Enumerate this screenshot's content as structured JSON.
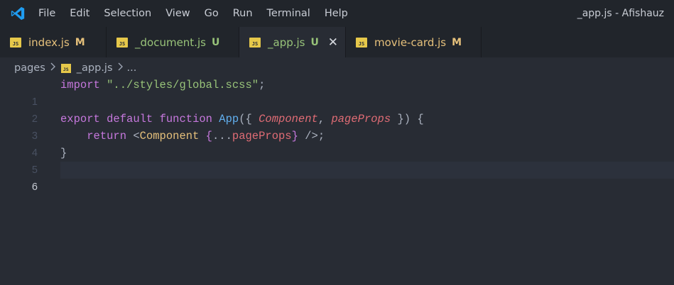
{
  "menu": [
    "File",
    "Edit",
    "Selection",
    "View",
    "Go",
    "Run",
    "Terminal",
    "Help"
  ],
  "window_title": "_app.js - Afishauz",
  "tabs": [
    {
      "label": "index.js",
      "status": "M",
      "label_color": "#e5c07b",
      "status_color": "#e5c07b",
      "active": false
    },
    {
      "label": "_document.js",
      "status": "U",
      "label_color": "#98c379",
      "status_color": "#98c379",
      "active": false
    },
    {
      "label": "_app.js",
      "status": "U",
      "label_color": "#98c379",
      "status_color": "#98c379",
      "active": true
    },
    {
      "label": "movie-card.js",
      "status": "M",
      "label_color": "#e5c07b",
      "status_color": "#e5c07b",
      "active": false
    }
  ],
  "tab_icon_text": "JS",
  "close_glyph": "✕",
  "breadcrumb": {
    "folder": "pages",
    "file": "_app.js",
    "more": "..."
  },
  "line_numbers": [
    "1",
    "2",
    "3",
    "4",
    "5",
    "6"
  ],
  "code": {
    "l1": {
      "kw": "import",
      "str": "\"../styles/global.scss\"",
      "end": ";"
    },
    "l3": {
      "kw1": "export",
      "kw2": "default",
      "kw3": "function",
      "fn": "App",
      "open": "({ ",
      "p1": "Component",
      "comma": ", ",
      "p2": "pageProps",
      "close": " }) {"
    },
    "l4": {
      "indent": "    ",
      "kw": "return",
      "lt": " <",
      "tag": "Component",
      "sp": " ",
      "bo": "{",
      "spread": "...",
      "attr": "pageProps",
      "bc": "}",
      "end": " />;"
    },
    "l5": {
      "text": "}"
    }
  },
  "colors": {
    "accent_vscode": "#0078d4",
    "js_icon": "#e6c84a"
  }
}
